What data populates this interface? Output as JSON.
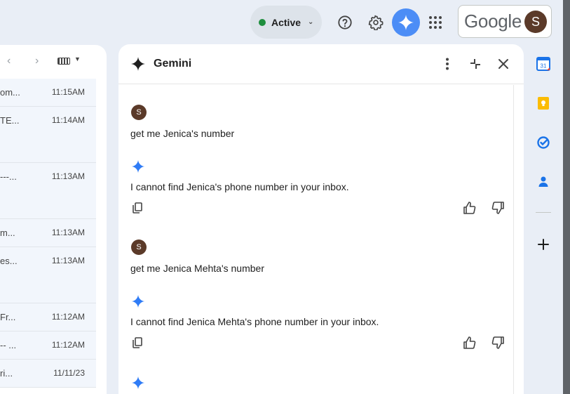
{
  "header": {
    "status_label": "Active",
    "google_word": "Google",
    "avatar_letter": "S"
  },
  "mail": {
    "rows": [
      {
        "snippet": "om...",
        "time": "11:15AM"
      },
      {
        "snippet": "TE...",
        "time": "11:14AM"
      },
      {
        "snippet": "---...",
        "time": "11:13AM"
      },
      {
        "snippet": "m...",
        "time": "11:13AM"
      },
      {
        "snippet": "es...",
        "time": "11:13AM"
      },
      {
        "snippet": "Fr...",
        "time": "11:12AM"
      },
      {
        "snippet": "-- ...",
        "time": "11:12AM"
      },
      {
        "snippet": "ri...",
        "time": "11/11/23"
      }
    ]
  },
  "gemini": {
    "title": "Gemini",
    "messages": [
      {
        "role": "user",
        "avatar": "S",
        "text": "get me Jenica's number"
      },
      {
        "role": "model",
        "text": "I cannot find Jenica's phone number in your inbox."
      },
      {
        "role": "user",
        "avatar": "S",
        "text": "get me Jenica Mehta's number"
      },
      {
        "role": "model",
        "text": "I cannot find Jenica Mehta's phone number in your inbox."
      }
    ]
  },
  "rail": {
    "calendar_day": "31"
  },
  "colors": {
    "accent_blue": "#4c8df6",
    "active_green": "#1e8e3e",
    "avatar_brown": "#5b3a29"
  }
}
